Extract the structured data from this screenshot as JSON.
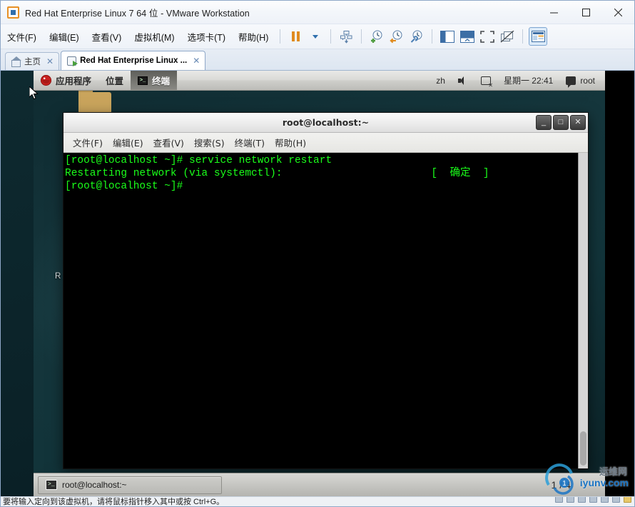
{
  "vmware": {
    "title": "Red Hat Enterprise Linux 7 64 位 - VMware Workstation",
    "app_icon": "vmware-logo-icon",
    "window_controls": {
      "minimize": "—",
      "maximize": "☐",
      "close": "✕"
    },
    "menu": [
      {
        "label": "文件(F)",
        "name": "menu-file"
      },
      {
        "label": "编辑(E)",
        "name": "menu-edit"
      },
      {
        "label": "查看(V)",
        "name": "menu-view"
      },
      {
        "label": "虚拟机(M)",
        "name": "menu-vm"
      },
      {
        "label": "选项卡(T)",
        "name": "menu-tabs"
      },
      {
        "label": "帮助(H)",
        "name": "menu-help"
      }
    ],
    "toolbar": [
      {
        "name": "pause-vm-button",
        "icon": "pause-icon"
      },
      {
        "name": "power-dropdown-button",
        "icon": "chevron-down-icon"
      },
      {
        "name": "manage-vm-button",
        "icon": "vm-settings-icon"
      },
      {
        "name": "take-snapshot-button",
        "icon": "snapshot-add-icon"
      },
      {
        "name": "revert-snapshot-button",
        "icon": "snapshot-revert-icon"
      },
      {
        "name": "snapshot-manager-button",
        "icon": "snapshot-manage-icon"
      },
      {
        "name": "show-library-button",
        "icon": "sidebar-panel-icon"
      },
      {
        "name": "show-thumbnail-bar-button",
        "icon": "thumbnail-bar-icon"
      },
      {
        "name": "fullscreen-button",
        "icon": "fullscreen-icon"
      },
      {
        "name": "unity-mode-button",
        "icon": "unity-mode-icon"
      },
      {
        "name": "console-view-button",
        "icon": "console-view-icon",
        "active": true
      }
    ],
    "tabs": [
      {
        "label": "主页",
        "icon": "home-icon",
        "active": false,
        "close": "✕"
      },
      {
        "label": "Red Hat Enterprise Linux ...",
        "icon": "vm-tab-icon",
        "active": true,
        "close": "✕"
      }
    ],
    "statusbar": {
      "text": "要将输入定向到该虚拟机，请将鼠标指针移入其中或按 Ctrl+G。"
    }
  },
  "guest": {
    "top_panel": {
      "logo": "redhat-logo-icon",
      "applications": "应用程序",
      "places": "位置",
      "terminal_window": "终端",
      "terminal_icon": "terminal-icon",
      "input_method": "zh",
      "volume_icon": "speaker-icon",
      "network_icon": "network-disconnected-icon",
      "clock": "星期一 22:41",
      "message_icon": "message-tray-icon",
      "user": "root"
    },
    "desktop": {
      "partial_label": "R"
    },
    "terminal": {
      "title": "root@localhost:~",
      "window_controls": {
        "minimize": "_",
        "maximize": "□",
        "close": "✕"
      },
      "menu": [
        {
          "label": "文件(F)",
          "name": "term-menu-file"
        },
        {
          "label": "编辑(E)",
          "name": "term-menu-edit"
        },
        {
          "label": "查看(V)",
          "name": "term-menu-view"
        },
        {
          "label": "搜索(S)",
          "name": "term-menu-search"
        },
        {
          "label": "终端(T)",
          "name": "term-menu-terminal"
        },
        {
          "label": "帮助(H)",
          "name": "term-menu-help"
        }
      ],
      "content": "[root@localhost ~]# service network restart\nRestarting network (via systemctl):                        [  确定  ]\n[root@localhost ~]# "
    },
    "taskbar": {
      "window_button": "root@localhost:~",
      "window_button_icon": "terminal-icon",
      "workspace_current": "1",
      "workspace_separator": "/",
      "workspace_total": "4"
    }
  },
  "watermark": {
    "cn": "运维网",
    "en": "iyunv.com"
  }
}
